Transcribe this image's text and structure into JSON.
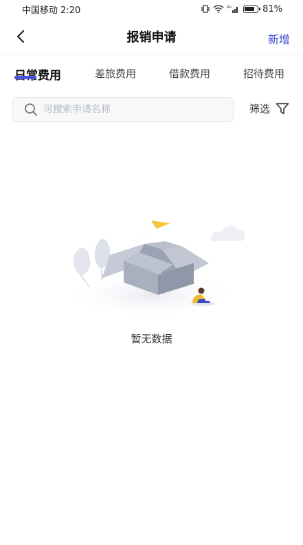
{
  "status_bar": {
    "carrier_time": "中国移动 2:20",
    "battery_percent": "81%",
    "battery_level": 0.81
  },
  "nav": {
    "title": "报销申请",
    "action_label": "新增"
  },
  "tabs": [
    {
      "label": "日常费用",
      "active": true
    },
    {
      "label": "差旅费用",
      "active": false
    },
    {
      "label": "借款费用",
      "active": false
    },
    {
      "label": "招待费用",
      "active": false
    }
  ],
  "search": {
    "placeholder": "可搜索申请名称",
    "value": ""
  },
  "filter": {
    "label": "筛选"
  },
  "empty_state": {
    "message": "暂无数据"
  },
  "colors": {
    "accent": "#3a4fd4",
    "indicator": "#4a52e0"
  }
}
